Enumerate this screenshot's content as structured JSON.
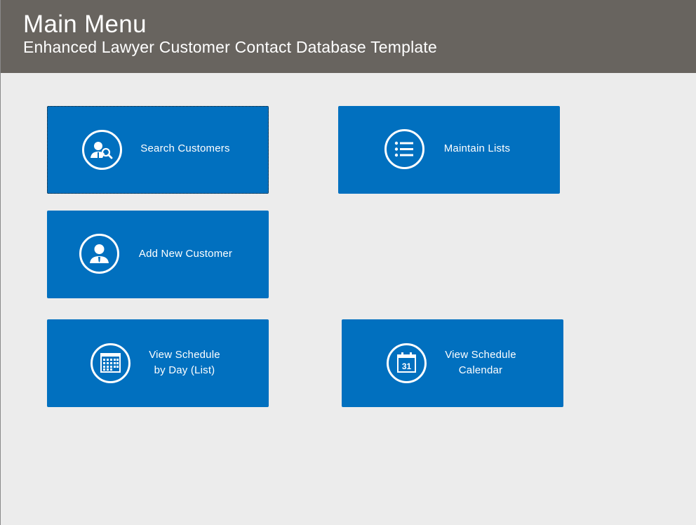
{
  "header": {
    "title": "Main Menu",
    "subtitle": "Enhanced Lawyer Customer Contact Database Template"
  },
  "tiles": {
    "search_customers": {
      "label": "Search Customers",
      "icon": "person-search-icon"
    },
    "maintain_lists": {
      "label": "Maintain Lists",
      "icon": "list-icon"
    },
    "add_new_customer": {
      "label": "Add New Customer",
      "icon": "person-icon"
    },
    "schedule_by_day": {
      "label": "View Schedule\nby Day (List)",
      "icon": "calendar-grid-icon"
    },
    "schedule_calendar": {
      "label": "View Schedule\nCalendar",
      "icon": "calendar-31-icon"
    }
  },
  "colors": {
    "header_bg": "#68645f",
    "page_bg": "#ececec",
    "tile_bg": "#0170bf",
    "text_on_dark": "#ffffff"
  }
}
